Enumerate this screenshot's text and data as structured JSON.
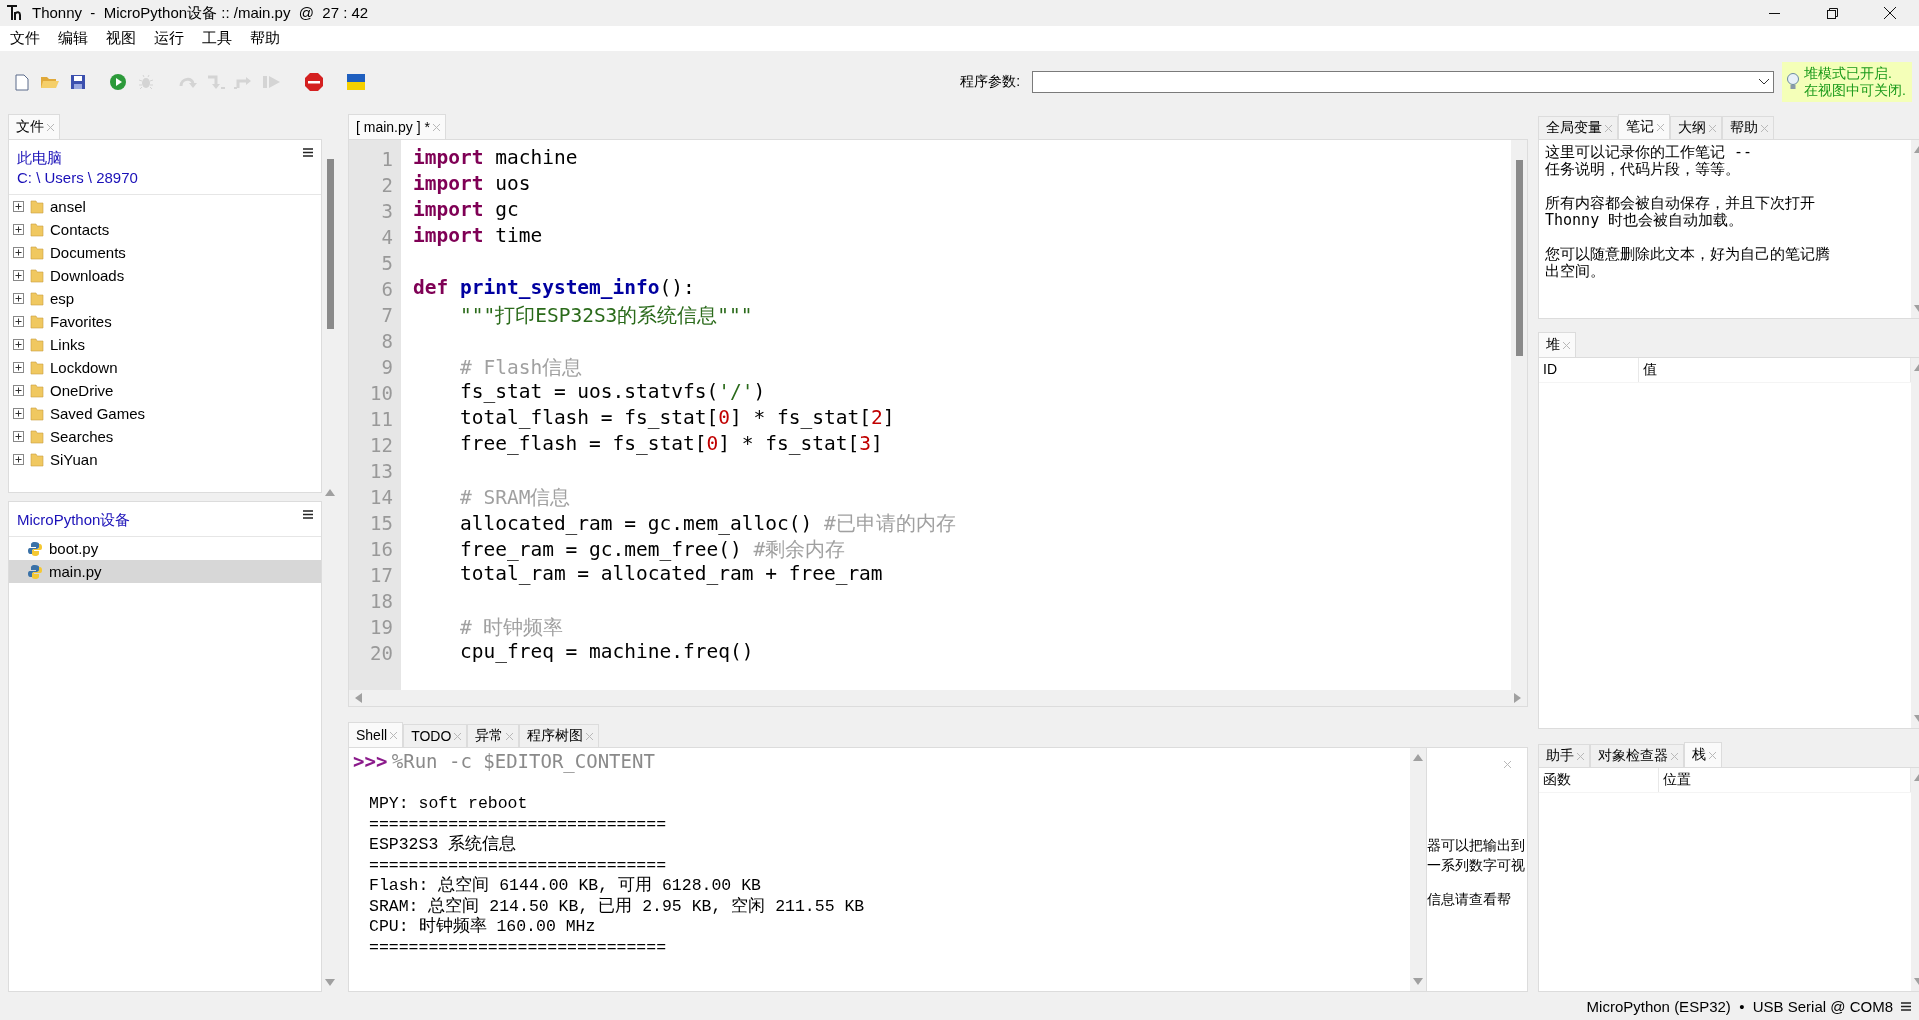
{
  "window": {
    "title": "Thonny  -  MicroPython设备 :: /main.py  @  27 : 42"
  },
  "menu": [
    "文件",
    "编辑",
    "视图",
    "运行",
    "工具",
    "帮助"
  ],
  "toolbar": {
    "buttons": [
      {
        "kind": "new",
        "disabled": false
      },
      {
        "kind": "open",
        "disabled": false
      },
      {
        "kind": "save",
        "disabled": false
      },
      {
        "kind": "run",
        "disabled": false
      },
      {
        "kind": "debug",
        "disabled": true
      },
      {
        "kind": "step_over",
        "disabled": true
      },
      {
        "kind": "step_into",
        "disabled": true
      },
      {
        "kind": "step_out",
        "disabled": true
      },
      {
        "kind": "resume",
        "disabled": true
      },
      {
        "kind": "stop",
        "disabled": false
      },
      {
        "kind": "flag",
        "disabled": false
      }
    ]
  },
  "program_args": {
    "label": "程序参数:"
  },
  "hint": {
    "lines": [
      "堆模式已开启.",
      "在视图中可关闭."
    ]
  },
  "files_panel": {
    "tabs": [
      {
        "label": "文件",
        "selected": true
      }
    ],
    "computer": {
      "title": "此电脑",
      "path": "C: \\ Users \\ 28970",
      "items": [
        {
          "name": "ansel",
          "expanded": false
        },
        {
          "name": "Contacts",
          "expanded": false
        },
        {
          "name": "Documents",
          "expanded": false
        },
        {
          "name": "Downloads",
          "expanded": false
        },
        {
          "name": "esp",
          "expanded": false
        },
        {
          "name": "Favorites",
          "expanded": false
        },
        {
          "name": "Links",
          "expanded": false
        },
        {
          "name": "Lockdown",
          "expanded": false
        },
        {
          "name": "OneDrive",
          "expanded": false
        },
        {
          "name": "Saved Games",
          "expanded": false
        },
        {
          "name": "Searches",
          "expanded": false
        },
        {
          "name": "SiYuan",
          "expanded": false
        }
      ]
    },
    "device": {
      "title": "MicroPython设备",
      "items": [
        {
          "name": "boot.py",
          "selected": false
        },
        {
          "name": "main.py",
          "selected": true
        }
      ]
    }
  },
  "editor": {
    "tabs": [
      {
        "label": "[ main.py ] *",
        "selected": true
      }
    ],
    "lines": [
      {
        "number": "1",
        "tokens": [
          {
            "kind": "keyword",
            "text": "import"
          },
          {
            "kind": "plain",
            "text": " machine"
          }
        ]
      },
      {
        "number": "2",
        "tokens": [
          {
            "kind": "keyword",
            "text": "import"
          },
          {
            "kind": "plain",
            "text": " uos"
          }
        ]
      },
      {
        "number": "3",
        "tokens": [
          {
            "kind": "keyword",
            "text": "import"
          },
          {
            "kind": "plain",
            "text": " gc"
          }
        ]
      },
      {
        "number": "4",
        "tokens": [
          {
            "kind": "keyword",
            "text": "import"
          },
          {
            "kind": "plain",
            "text": " time"
          }
        ]
      },
      {
        "number": "5"
      },
      {
        "number": "6",
        "tokens": [
          {
            "kind": "keyword",
            "text": "def"
          },
          {
            "kind": "function",
            "text": " print_system_info"
          },
          {
            "kind": "plain",
            "text": "():"
          }
        ]
      },
      {
        "number": "7",
        "tokens": [
          {
            "kind": "string",
            "text": "    \"\"\"打印ESP32S3的系统信息\"\"\""
          }
        ]
      },
      {
        "number": "8"
      },
      {
        "number": "9",
        "tokens": [
          {
            "kind": "comment",
            "text": "    # Flash信息"
          }
        ]
      },
      {
        "number": "10",
        "tokens": [
          {
            "kind": "plain",
            "text": "    fs_stat = uos.statvfs("
          },
          {
            "kind": "string",
            "text": "'/'"
          },
          {
            "kind": "plain",
            "text": ")"
          }
        ]
      },
      {
        "number": "11",
        "tokens": [
          {
            "kind": "plain",
            "text": "    total_flash = fs_stat["
          },
          {
            "kind": "number",
            "text": "0"
          },
          {
            "kind": "plain",
            "text": "] * fs_stat["
          },
          {
            "kind": "number",
            "text": "2"
          },
          {
            "kind": "plain",
            "text": "]"
          }
        ]
      },
      {
        "number": "12",
        "tokens": [
          {
            "kind": "plain",
            "text": "    free_flash = fs_stat["
          },
          {
            "kind": "number",
            "text": "0"
          },
          {
            "kind": "plain",
            "text": "] * fs_stat["
          },
          {
            "kind": "number",
            "text": "3"
          },
          {
            "kind": "plain",
            "text": "]"
          }
        ]
      },
      {
        "number": "13"
      },
      {
        "number": "14",
        "tokens": [
          {
            "kind": "comment",
            "text": "    # SRAM信息"
          }
        ]
      },
      {
        "number": "15",
        "tokens": [
          {
            "kind": "plain",
            "text": "    allocated_ram = gc.mem_alloc() "
          },
          {
            "kind": "comment",
            "text": "#已申请的内存"
          }
        ]
      },
      {
        "number": "16",
        "tokens": [
          {
            "kind": "plain",
            "text": "    free_ram = gc.mem_free() "
          },
          {
            "kind": "comment",
            "text": "#剩余内存"
          }
        ]
      },
      {
        "number": "17",
        "tokens": [
          {
            "kind": "plain",
            "text": "    total_ram = allocated_ram + free_ram"
          }
        ]
      },
      {
        "number": "18"
      },
      {
        "number": "19",
        "tokens": [
          {
            "kind": "comment",
            "text": "    # 时钟频率"
          }
        ]
      },
      {
        "number": "20",
        "tokens": [
          {
            "kind": "plain",
            "text": "    cpu_freq = machine.freq()"
          }
        ]
      }
    ]
  },
  "shell": {
    "tabs": [
      {
        "label": "Shell",
        "selected": true
      },
      {
        "label": "TODO",
        "selected": false
      },
      {
        "label": "异常",
        "selected": false
      },
      {
        "label": "程序树图",
        "selected": false
      }
    ],
    "prompt": ">>>",
    "command": "%Run -c $EDITOR_CONTENT",
    "output": [
      "MPY: soft reboot",
      "==============================",
      "ESP32S3 系统信息",
      "==============================",
      "Flash: 总空间 6144.00 KB, 可用 6128.00 KB",
      "SRAM: 总空间 214.50 KB, 已用 2.95 KB, 空闲 211.55 KB",
      "CPU: 时钟频率 160.00 MHz",
      "=============================="
    ],
    "side_paragraphs": [
      {
        "lines": [
          "器可以把输出到",
          "一系列数字可视"
        ]
      },
      {
        "lines": [
          "信息请查看帮"
        ]
      }
    ]
  },
  "notes": {
    "tabs": [
      {
        "label": "全局变量",
        "selected": false
      },
      {
        "label": "笔记",
        "selected": true
      },
      {
        "label": "大纲",
        "selected": false
      },
      {
        "label": "帮助",
        "selected": false
      }
    ],
    "paragraphs": [
      {
        "lines": [
          "这里可以记录你的工作笔记 --",
          "任务说明，代码片段，等等。"
        ]
      },
      {
        "lines": [
          "所有内容都会被自动保存，并且下次打开",
          "Thonny 时也会被自动加载。"
        ]
      },
      {
        "lines": [
          "您可以随意删除此文本，好为自己的笔记腾",
          "出空间。"
        ]
      }
    ]
  },
  "heap": {
    "tabs": [
      {
        "label": "堆",
        "selected": true
      }
    ],
    "columns": [
      "ID",
      "值"
    ]
  },
  "stack": {
    "tabs": [
      {
        "label": "助手",
        "selected": false
      },
      {
        "label": "对象检查器",
        "selected": false
      },
      {
        "label": "栈",
        "selected": true
      }
    ],
    "columns": [
      "函数",
      "位置"
    ]
  },
  "status_bar": {
    "text": "MicroPython (ESP32)  •  USB Serial @ COM8"
  }
}
